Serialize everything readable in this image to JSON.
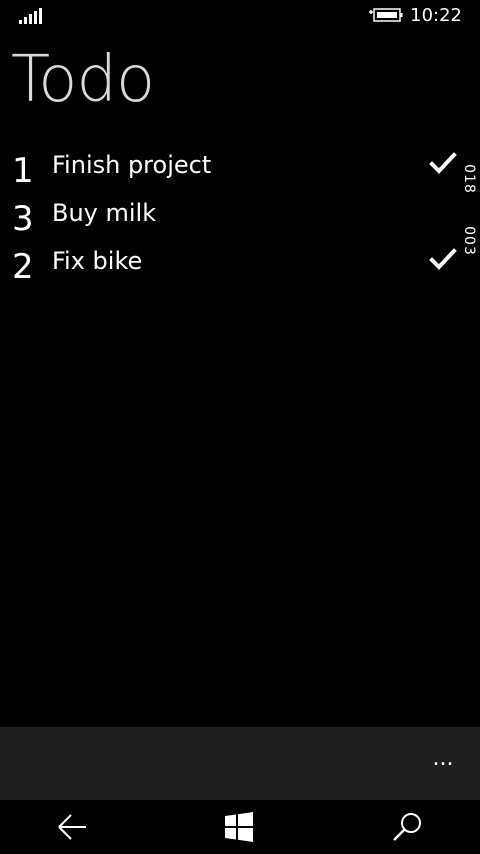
{
  "status_bar": {
    "signal_icon": "signal-strength-icon",
    "battery_icon": "battery-charging-icon",
    "time": "10:22"
  },
  "page": {
    "title": "Todo"
  },
  "todos": [
    {
      "number": "1",
      "text": "Finish project",
      "checked": true
    },
    {
      "number": "3",
      "text": "Buy milk",
      "checked": false
    },
    {
      "number": "2",
      "text": "Fix bike",
      "checked": true
    }
  ],
  "side_counters": [
    "018",
    "003"
  ],
  "app_bar": {
    "more_label": "..."
  },
  "nav_bar": {
    "back_icon": "back-arrow-icon",
    "start_icon": "windows-logo-icon",
    "search_icon": "search-icon"
  },
  "colors": {
    "background": "#000000",
    "title": "#d9d9d9",
    "app_bar": "#1f1f1f",
    "text": "#ffffff"
  }
}
